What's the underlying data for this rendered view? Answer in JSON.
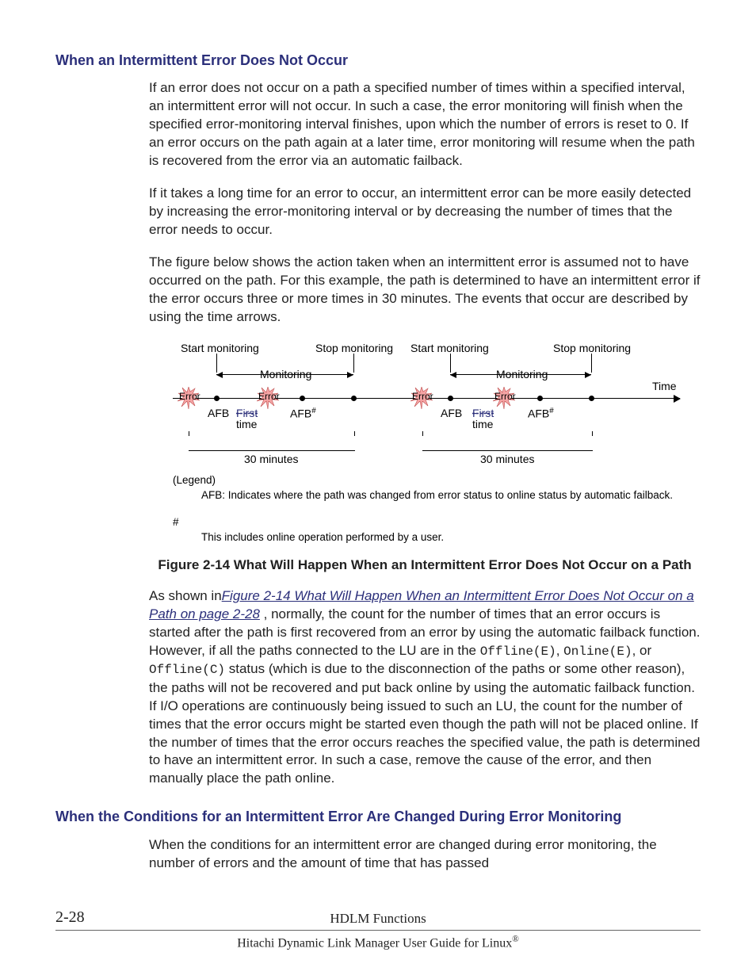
{
  "section1": {
    "heading": "When an Intermittent Error Does Not Occur",
    "p1": "If an error does not occur on a path a specified number of times within a specified interval, an intermittent error will not occur. In such a case, the error monitoring will finish when the specified error-monitoring interval finishes, upon which the number of errors is reset to 0. If an error occurs on the path again at a later time, error monitoring will resume when the path is recovered from the error via an automatic failback.",
    "p2": "If it takes a long time for an error to occur, an intermittent error can be more easily detected by increasing the error-monitoring interval or by decreasing the number of times that the error needs to occur.",
    "p3": "The figure below shows the action taken when an intermittent error is assumed not to have occurred on the path. For this example, the path is determined to have an intermittent error if the error occurs three or more times in 30 minutes. The events that occur are described by using the time arrows."
  },
  "figure": {
    "labels": {
      "start": "Start monitoring",
      "stop": "Stop monitoring",
      "monitoring": "Monitoring",
      "time": "Time",
      "error": "Error",
      "afb": "AFB",
      "afbhash": "AFB",
      "first": "First",
      "timeword": "time",
      "thirty": "30 minutes"
    },
    "legend": {
      "title": "(Legend)",
      "afb": "AFB: Indicates where the path was changed from error status to online status by automatic failback.",
      "hash": "#",
      "hashbody": "This includes online operation performed by a user."
    },
    "caption": "Figure 2-14 What Will Happen When an Intermittent Error Does Not Occur on a Path"
  },
  "after_figure": {
    "lead": "As shown in",
    "xref": "Figure 2-14 What Will Happen When an Intermittent Error Does Not Occur on a Path on page 2-28",
    "rest1": " , normally, the count for the number of times that an error occurs is started after the path is first recovered from an error by using the automatic failback function. However, if all the paths connected to the LU are in the ",
    "code1": "Offline(E)",
    "mid1": ", ",
    "code2": "Online(E)",
    "mid2": ", or ",
    "code3": "Offline(C)",
    "rest2": " status (which is due to the disconnection of the paths or some other reason), the paths will not be recovered and put back online by using the automatic failback function. If I/O operations are continuously being issued to such an LU, the count for the number of times that the error occurs might be started even though the path will not be placed online. If the number of times that the error occurs reaches the specified value, the path is determined to have an intermittent error. In such a case, remove the cause of the error, and then manually place the path online."
  },
  "section2": {
    "heading": "When the Conditions for an Intermittent Error Are Changed During Error Monitoring",
    "p1": "When the conditions for an intermittent error are changed during error monitoring, the number of errors and the amount of time that has passed"
  },
  "footer": {
    "page": "2-28",
    "line1": "HDLM Functions",
    "line2_a": "Hitachi Dynamic Link Manager User Guide for Linux",
    "line2_b": "®"
  }
}
